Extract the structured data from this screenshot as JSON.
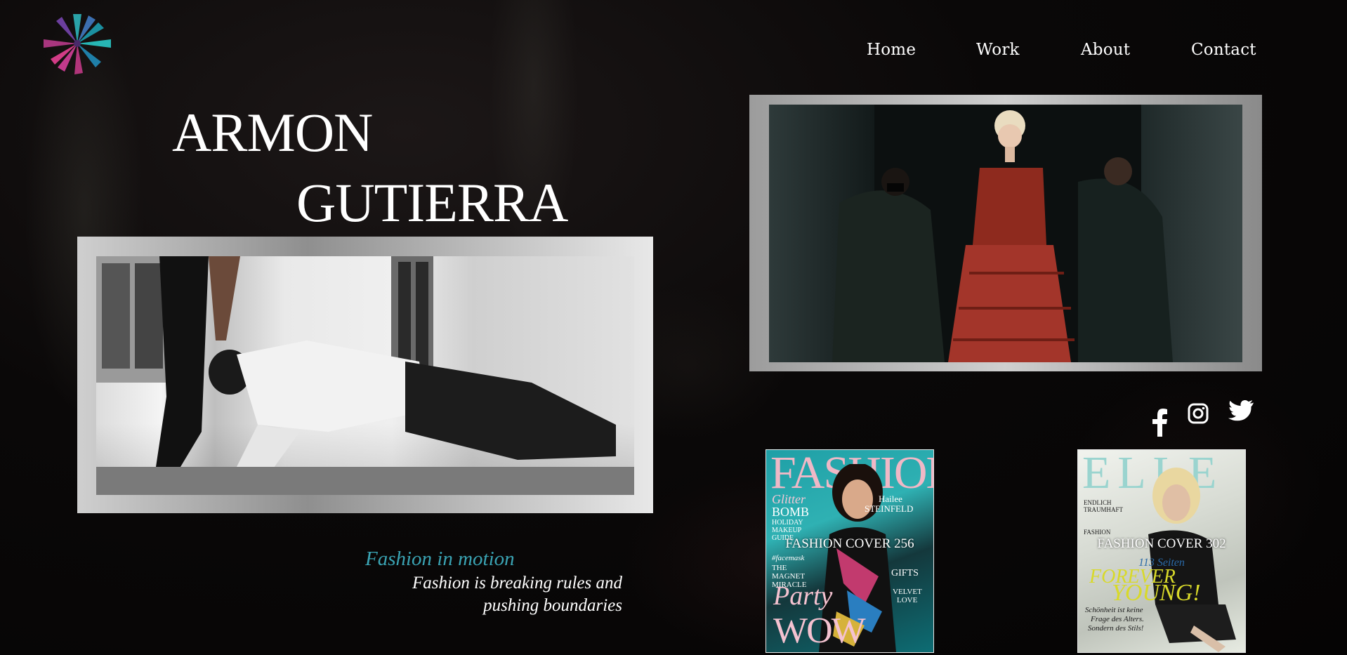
{
  "nav": {
    "items": [
      "Home",
      "Work",
      "About",
      "Contact"
    ]
  },
  "hero": {
    "first_name": "ARMON",
    "last_name": "GUTIERRA"
  },
  "tagline": {
    "title": "Fashion in motion",
    "line1": "Fashion is breaking rules and",
    "line2": "pushing boundaries"
  },
  "social": [
    "facebook-icon",
    "instagram-icon",
    "twitter-icon"
  ],
  "covers": [
    {
      "masthead": "FASHION",
      "caption": "FASHION COVER 256",
      "lines": [
        "Glitter",
        "BOMB",
        "HOLIDAY",
        "MAKEUP",
        "GUIDE",
        "Hailee",
        "STEINFELD",
        "#facemask",
        "THE",
        "MAGNET",
        "MIRACLE",
        "Party",
        "WOW",
        "GIFTS",
        "VELVET",
        "LOVE"
      ]
    },
    {
      "masthead": "ELLE",
      "caption": "FASHION COVER 302",
      "lines": [
        "ENDLICH",
        "TRAUMHAFT",
        "FASHION",
        "113 Seiten",
        "FOREVER",
        "YOUNG!",
        "Schönheit ist keine",
        "Frage des Alters.",
        "Sondern des Stils!"
      ]
    }
  ],
  "colors": {
    "accent": "#3aa3b3",
    "background": "#0a0808",
    "text": "#ffffff"
  }
}
